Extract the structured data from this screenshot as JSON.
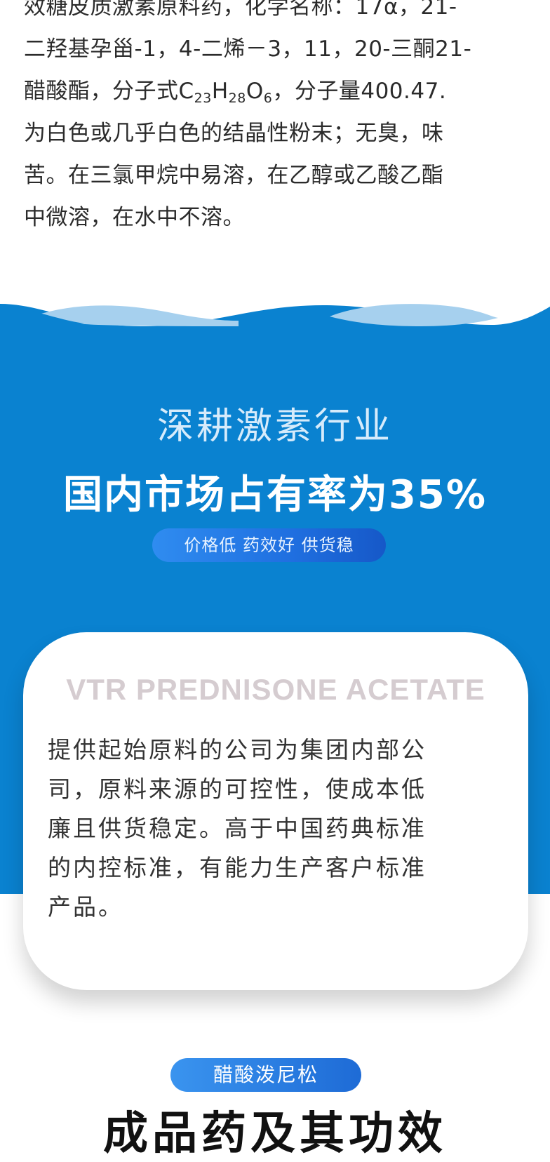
{
  "intro": {
    "line1": "效糖皮质激素原料药，化学名称：17α，21-",
    "line2": "二羟基孕甾-1，4-二烯－3，11，20-三酮21-",
    "line3_pre": "醋酸酯，分子式C",
    "sub1": "23",
    "mid1": "H",
    "sub2": "28",
    "mid2": "O",
    "sub3": "6",
    "line3_post": "，分子量400.47.",
    "line4": "为白色或几乎白色的结晶性粉末；无臭，味",
    "line5": "苦。在三氯甲烷中易溶，在乙醇或乙酸乙酯",
    "line6": "中微溶，在水中不溶。"
  },
  "hero": {
    "headline_light": "深耕激素行业",
    "headline_bold": "国内市场占有率为35%",
    "pill": "价格低  药效好  供货稳"
  },
  "card": {
    "title": "VTR PREDNISONE ACETATE",
    "line1": "提供起始原料的公司为集团内部公",
    "line2": "司，原料来源的可控性，使成本低",
    "line3": "廉且供货稳定。高于中国药典标准",
    "line4": "的内控标准，有能力生产客户标准",
    "line5": "产品。"
  },
  "section": {
    "tag": "醋酸泼尼松",
    "title": "成品药及其功效"
  },
  "colors": {
    "band_blue": "#0a82d0",
    "wave_light": "#a6d0ee",
    "pill_blue": "#1f6fe0"
  }
}
